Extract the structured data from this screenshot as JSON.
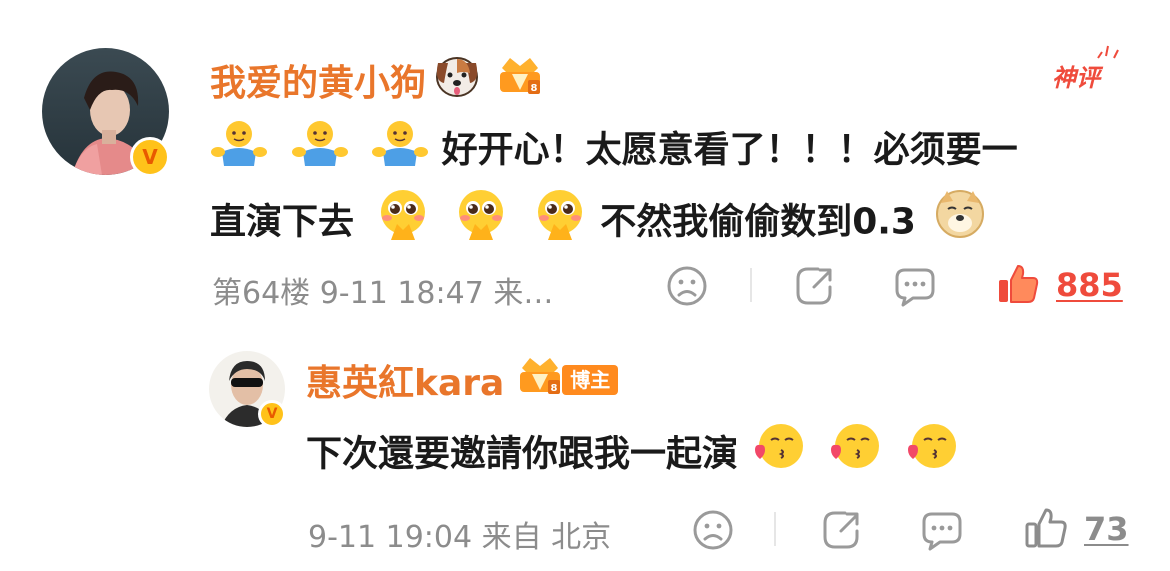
{
  "comment": {
    "username": "我爱的黄小狗",
    "badge_label": "神评",
    "text_part1": "好开心！太愿意看了！！！必须要一",
    "text_part2": "直演下去",
    "text_part3": "不然我偷偷数到0.3",
    "floor_time": "第64楼 9-11 18:47 来…",
    "like_count": "885",
    "liked": true
  },
  "reply": {
    "username": "惠英紅kara",
    "role_label": "博主",
    "text": "下次還要邀請你跟我一起演",
    "time_source": "9-11 19:04 来自 北京",
    "like_count": "73",
    "liked": false
  },
  "colors": {
    "username": "#e9762b",
    "like_active": "#ef4b3c",
    "meta": "#8c8c8c",
    "icon": "#9a9a9a"
  },
  "icons": [
    "dog-emoji-icon",
    "crown-medal-icon",
    "hug-emoji-icon",
    "pleading-emoji-icon",
    "doge-emoji-icon",
    "dislike-face-icon",
    "share-icon",
    "comment-icon",
    "thumbs-up-icon",
    "kiss-emoji-icon",
    "verified-v-icon"
  ]
}
